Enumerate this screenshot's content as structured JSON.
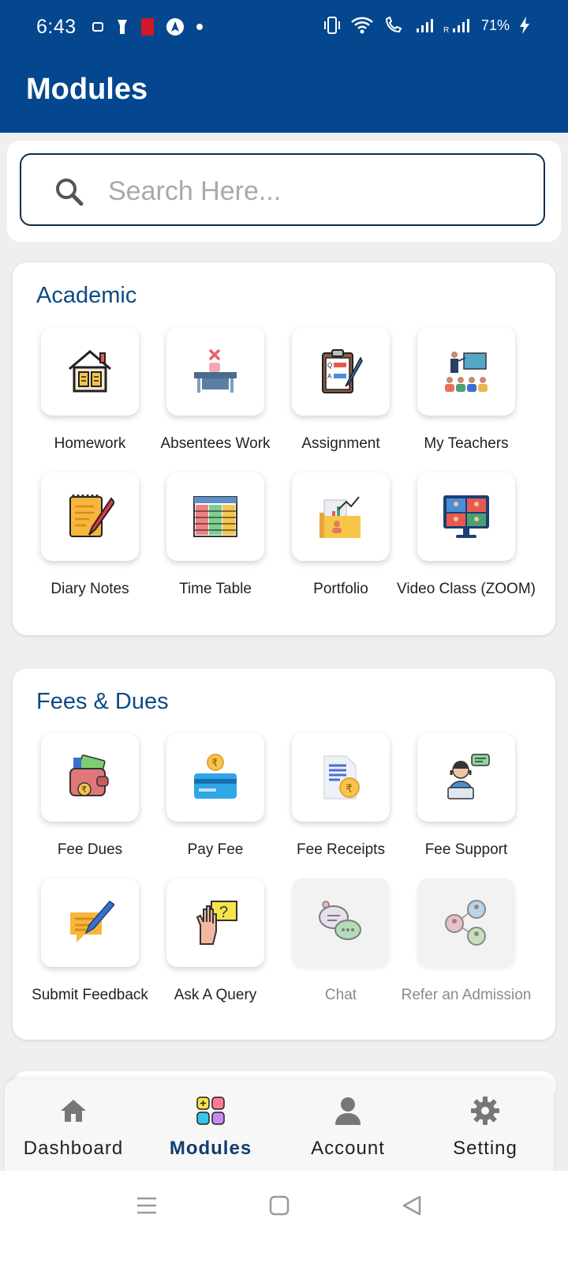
{
  "status_bar": {
    "time": "6:43",
    "battery": "71%"
  },
  "header": {
    "title": "Modules"
  },
  "search": {
    "placeholder": "Search Here..."
  },
  "sections": [
    {
      "title": "Academic",
      "items": [
        {
          "label": "Homework",
          "icon": "homework-icon",
          "enabled": true
        },
        {
          "label": "Absentees Work",
          "icon": "absentees-work-icon",
          "enabled": true
        },
        {
          "label": "Assignment",
          "icon": "assignment-icon",
          "enabled": true
        },
        {
          "label": "My Teachers",
          "icon": "teachers-icon",
          "enabled": true
        },
        {
          "label": "Diary Notes",
          "icon": "diary-notes-icon",
          "enabled": true
        },
        {
          "label": "Time Table",
          "icon": "time-table-icon",
          "enabled": true
        },
        {
          "label": "Portfolio",
          "icon": "portfolio-icon",
          "enabled": true
        },
        {
          "label": "Video Class (ZOOM)",
          "icon": "video-class-icon",
          "enabled": true
        }
      ]
    },
    {
      "title": "Fees & Dues",
      "items": [
        {
          "label": "Fee Dues",
          "icon": "fee-dues-icon",
          "enabled": true
        },
        {
          "label": "Pay Fee",
          "icon": "pay-fee-icon",
          "enabled": true
        },
        {
          "label": "Fee Receipts",
          "icon": "fee-receipts-icon",
          "enabled": true
        },
        {
          "label": "Fee Support",
          "icon": "fee-support-icon",
          "enabled": true
        },
        {
          "label": "Submit Feedback",
          "icon": "feedback-icon",
          "enabled": true
        },
        {
          "label": "Ask A Query",
          "icon": "query-icon",
          "enabled": true
        },
        {
          "label": "Chat",
          "icon": "chat-icon",
          "enabled": false
        },
        {
          "label": "Refer an Admission",
          "icon": "refer-icon",
          "enabled": false
        }
      ]
    }
  ],
  "bottom_nav": [
    {
      "label": "Dashboard",
      "icon": "home-icon",
      "active": false
    },
    {
      "label": "Modules",
      "icon": "modules-icon",
      "active": true
    },
    {
      "label": "Account",
      "icon": "person-icon",
      "active": false
    },
    {
      "label": "Setting",
      "icon": "gear-icon",
      "active": false
    }
  ],
  "colors": {
    "header": "#05478f",
    "section_title": "#0e4a85",
    "active_nav": "#0e3d72"
  }
}
